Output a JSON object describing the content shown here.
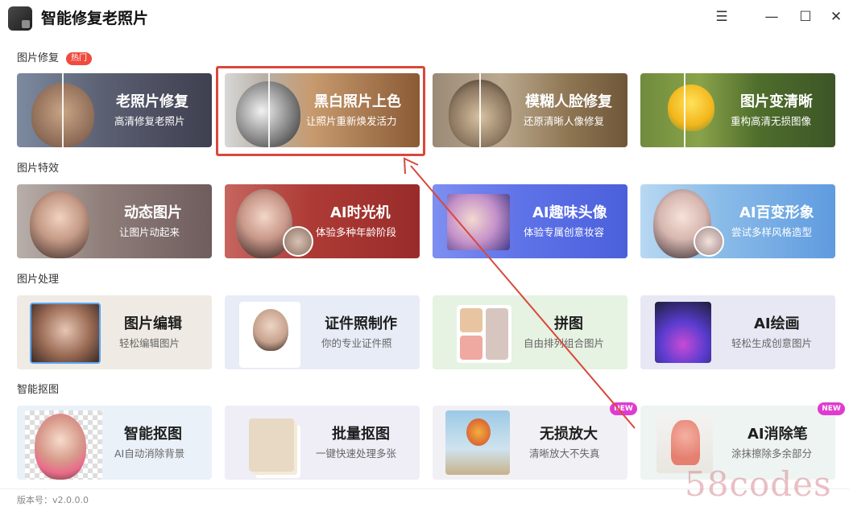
{
  "app": {
    "title": "智能修复老照片",
    "version": "版本号：v2.0.0.0"
  },
  "window_buttons": {
    "menu": "☰",
    "minimize": "—",
    "maximize": "☐",
    "close": "✕"
  },
  "sections": [
    {
      "label": "图片修复",
      "badge": "热门",
      "cards": [
        {
          "title": "老照片修复",
          "subtitle": "高清修复老照片"
        },
        {
          "title": "黑白照片上色",
          "subtitle": "让照片重新焕发活力"
        },
        {
          "title": "模糊人脸修复",
          "subtitle": "还原清晰人像修复"
        },
        {
          "title": "图片变清晰",
          "subtitle": "重构高清无损图像"
        }
      ]
    },
    {
      "label": "图片特效",
      "cards": [
        {
          "title": "动态图片",
          "subtitle": "让图片动起来"
        },
        {
          "title": "AI时光机",
          "subtitle": "体验多种年龄阶段"
        },
        {
          "title": "AI趣味头像",
          "subtitle": "体验专属创意妆容"
        },
        {
          "title": "AI百变形象",
          "subtitle": "尝试多样风格造型"
        }
      ]
    },
    {
      "label": "图片处理",
      "cards": [
        {
          "title": "图片编辑",
          "subtitle": "轻松编辑图片"
        },
        {
          "title": "证件照制作",
          "subtitle": "你的专业证件照"
        },
        {
          "title": "拼图",
          "subtitle": "自由排列组合图片"
        },
        {
          "title": "AI绘画",
          "subtitle": "轻松生成创意图片"
        }
      ]
    },
    {
      "label": "智能抠图",
      "cards": [
        {
          "title": "智能抠图",
          "subtitle": "AI自动消除背景"
        },
        {
          "title": "批量抠图",
          "subtitle": "一键快速处理多张"
        },
        {
          "title": "无损放大",
          "subtitle": "清晰放大不失真",
          "badge": "NEW"
        },
        {
          "title": "AI消除笔",
          "subtitle": "涂抹擦除多余部分",
          "badge": "NEW"
        }
      ]
    }
  ],
  "watermark": "58codes",
  "colors": {
    "highlight": "#d9483b",
    "hot_badge": "#ef4b3e",
    "new_badge": "#e03bd0"
  }
}
